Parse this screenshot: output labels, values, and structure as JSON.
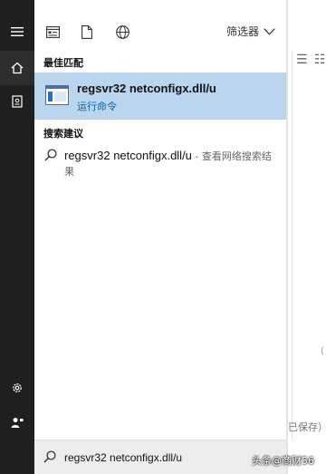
{
  "toolbar": {
    "filter_label": "筛选器"
  },
  "best_match": {
    "section_title": "最佳匹配",
    "title": "regsvr32 netconfigx.dll/u",
    "subtitle": "运行命令"
  },
  "suggestions": {
    "section_title": "搜索建议",
    "items": [
      {
        "query": "regsvr32 netconfigx.dll/u",
        "suffix": " - 查看网络搜索结果"
      }
    ]
  },
  "search": {
    "value": "regsvr32 netconfigx.dll/u"
  },
  "background_app": {
    "status_text": "已保存）",
    "bracket": "("
  },
  "watermark": "头条@商财56"
}
